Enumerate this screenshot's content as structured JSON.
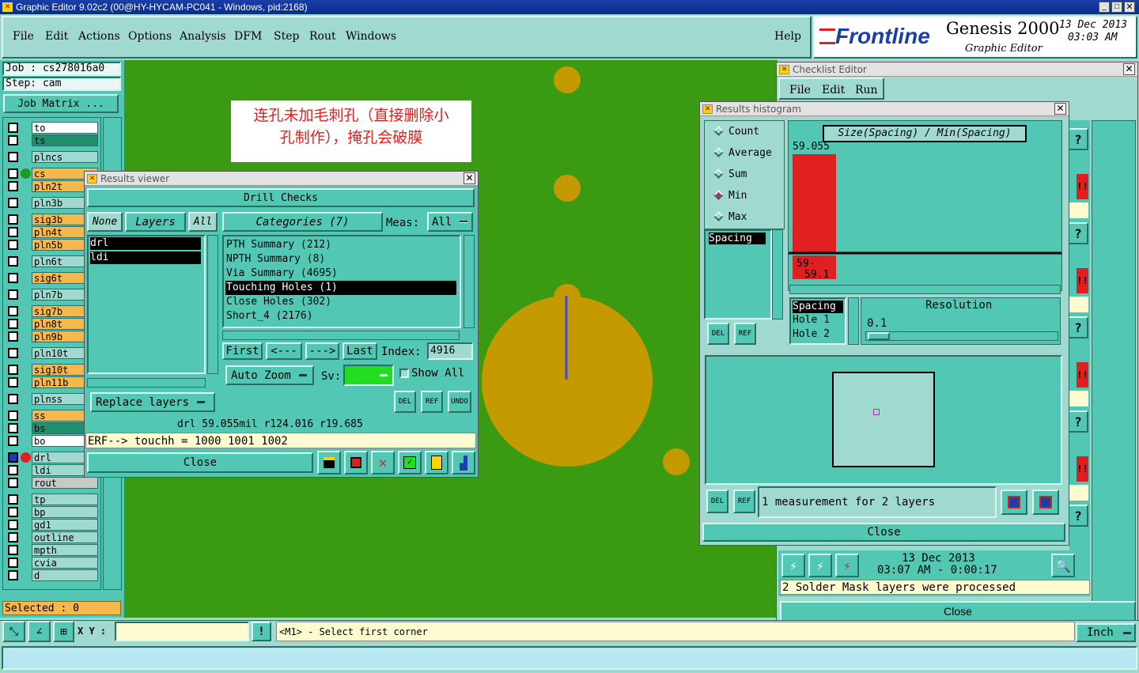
{
  "titlebar": {
    "title": "Graphic Editor 9.02c2 (00@HY-HYCAM-PC041 - Windows, pid:2168)"
  },
  "menu": {
    "items": [
      "File",
      "Edit",
      "Actions",
      "Options",
      "Analysis",
      "DFM",
      "Step",
      "Rout",
      "Windows"
    ],
    "help": "Help"
  },
  "brand": {
    "logo": "Frontline",
    "product": "Genesis 2000",
    "subtitle": "Graphic Editor",
    "date": "13 Dec 2013",
    "time": "03:03 AM"
  },
  "job": {
    "job": "Job : cs278016a0",
    "step": "Step: cam",
    "matrix_button": "Job Matrix ..."
  },
  "layers": [
    {
      "name": "to",
      "color": "#ffffff",
      "sel": "none"
    },
    {
      "name": "ts",
      "color": "#1e8f6e",
      "sel": "none"
    },
    {
      "name": "plncs",
      "color": "#9fd9d0",
      "sel": "none"
    },
    {
      "name": "cs",
      "color": "#f7b84b",
      "sel": "green"
    },
    {
      "name": "pln2t",
      "color": "#f7b84b",
      "sel": "none"
    },
    {
      "name": "pln3b",
      "color": "#9fd9d0",
      "sel": "none"
    },
    {
      "name": "sig3b",
      "color": "#f7b84b",
      "sel": "none"
    },
    {
      "name": "pln4t",
      "color": "#f7b84b",
      "sel": "none"
    },
    {
      "name": "pln5b",
      "color": "#f7b84b",
      "sel": "none"
    },
    {
      "name": "pln6t",
      "color": "#9fd9d0",
      "sel": "none"
    },
    {
      "name": "sig6t",
      "color": "#f7b84b",
      "sel": "none"
    },
    {
      "name": "pln7b",
      "color": "#9fd9d0",
      "sel": "none"
    },
    {
      "name": "sig7b",
      "color": "#f7b84b",
      "sel": "none"
    },
    {
      "name": "pln8t",
      "color": "#f7b84b",
      "sel": "none"
    },
    {
      "name": "pln9b",
      "color": "#f7b84b",
      "sel": "none"
    },
    {
      "name": "pln10t",
      "color": "#9fd9d0",
      "sel": "none"
    },
    {
      "name": "sig10t",
      "color": "#f7b84b",
      "sel": "none"
    },
    {
      "name": "pln11b",
      "color": "#f7b84b",
      "sel": "none"
    },
    {
      "name": "plnss",
      "color": "#9fd9d0",
      "sel": "none"
    },
    {
      "name": "ss",
      "color": "#f7b84b",
      "sel": "none"
    },
    {
      "name": "bs",
      "color": "#1e8f6e",
      "sel": "none"
    },
    {
      "name": "bo",
      "color": "#ffffff",
      "sel": "none"
    },
    {
      "name": "drl",
      "color": "#9fd9d0",
      "sel": "red"
    },
    {
      "name": "ldi",
      "color": "#9fd9d0",
      "sel": "none"
    },
    {
      "name": "rout",
      "color": "#c8c8c8",
      "sel": "none"
    },
    {
      "name": "tp",
      "color": "#9fd9d0",
      "sel": "none"
    },
    {
      "name": "bp",
      "color": "#9fd9d0",
      "sel": "none"
    },
    {
      "name": "gd1",
      "color": "#9fd9d0",
      "sel": "none"
    },
    {
      "name": "outline",
      "color": "#9fd9d0",
      "sel": "none"
    },
    {
      "name": "mpth",
      "color": "#9fd9d0",
      "sel": "none"
    },
    {
      "name": "cvia",
      "color": "#9fd9d0",
      "sel": "none"
    },
    {
      "name": "d",
      "color": "#9fd9d0",
      "sel": "none"
    }
  ],
  "selected": "Selected : 0",
  "annotation": {
    "line1": "连孔未加毛刺孔（直接删除小",
    "line2": "孔制作），掩孔会破膜"
  },
  "results_viewer": {
    "title": "Results viewer",
    "header": "Drill Checks",
    "none": "None",
    "layers": "Layers",
    "all": "All",
    "layer_items": [
      "drl",
      "ldi"
    ],
    "categories_label": "Categories (7)",
    "meas_label": "Meas:",
    "meas_value": "All",
    "categories": [
      "PTH Summary (212)",
      "NPTH Summary (8)",
      "Via Summary (4695)",
      "Touching Holes (1)",
      "Close Holes (302)",
      "Short_4 (2176)"
    ],
    "first": "First",
    "prev": "<---",
    "next": "--->",
    "last": "Last",
    "index_label": "Index:",
    "index_value": "4916",
    "auto_zoom": "Auto Zoom",
    "sv_label": "Sv:",
    "show_all": "Show All",
    "replace_layers": "Replace layers",
    "del": "DEL",
    "ref": "REF",
    "undo": "UNDO",
    "info": "drl 59.055mil  r124.016  r19.685",
    "erf": "ERF--> touchh = 1000 1001 1002",
    "close": "Close"
  },
  "checklist": {
    "title": "Checklist Editor",
    "menu": [
      "File",
      "Edit",
      "Run"
    ],
    "date": "13 Dec 2013",
    "time": "03:07 AM - 0:00:17",
    "status": "2 Solder Mask layers were processed",
    "close": "Close"
  },
  "histogram": {
    "title": "Results histogram",
    "options": [
      "Count",
      "Average",
      "Sum",
      "Min",
      "Max"
    ],
    "selected_option": "Min",
    "list_item": "Spacing",
    "header": "Size(Spacing) / Min(Spacing)",
    "del": "DEL",
    "ref": "REF",
    "sort_items": [
      "Spacing",
      "Hole 1",
      "Hole 2"
    ],
    "resolution_label": "Resolution",
    "resolution_value": "0.1",
    "status": "1 measurement for 2 layers",
    "close": "Close"
  },
  "chart_data": {
    "type": "bar",
    "categories": [
      "59-59.1"
    ],
    "values": [
      59.055
    ],
    "title": "Size(Spacing) / Min(Spacing)",
    "value_label": "59.055",
    "category_label_lines": [
      "59-",
      "59.1"
    ]
  },
  "bottom": {
    "xy_label": "X Y :",
    "xy_value": "",
    "prompt": "<M1> - Select first corner",
    "unit": "Inch"
  },
  "colors": {
    "canvas": "#3a9a12",
    "pad": "#c49a00",
    "accent_red": "#e02020",
    "teal": "#52c7b3"
  }
}
